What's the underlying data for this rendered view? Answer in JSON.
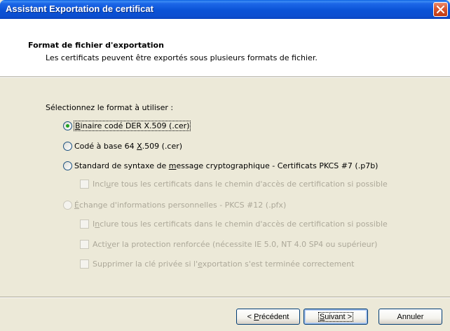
{
  "window": {
    "title": "Assistant Exportation de certificat"
  },
  "header": {
    "title": "Format de fichier d'exportation",
    "subtitle": "Les certificats peuvent être exportés sous plusieurs formats de fichier."
  },
  "prompt": "Sélectionnez le format à utiliser :",
  "options": {
    "der": {
      "mnemonic": "B",
      "rest": "inaire codé DER X.509 (.cer)",
      "selected": true
    },
    "base64": {
      "before": "Codé à base 64 ",
      "mnemonic": "X",
      "after": ".509 (.cer)",
      "selected": false
    },
    "pkcs7": {
      "before": "Standard de syntaxe de ",
      "mnemonic": "m",
      "after": "essage cryptographique - Certificats PKCS #7 (.p7b)",
      "selected": false
    },
    "pkcs7_include": {
      "before": "Incl",
      "mnemonic": "u",
      "after": "re tous les certificats dans le chemin d'accès de certification si possible",
      "checked": false,
      "enabled": false
    },
    "pfx": {
      "before": "",
      "mnemonic": "É",
      "after": "change d'informations personnelles - PKCS #12 (.pfx)",
      "selected": false,
      "enabled": false
    },
    "pfx_include": {
      "before": "I",
      "mnemonic": "n",
      "after": "clure tous les certificats dans le chemin d'accès de certification si possible",
      "checked": false,
      "enabled": false
    },
    "pfx_strong": {
      "before": "Acti",
      "mnemonic": "v",
      "after": "er la protection renforcée (nécessite IE 5.0, NT 4.0 SP4 ou supérieur)",
      "checked": false,
      "enabled": false
    },
    "pfx_delete": {
      "before": "Supprimer la clé privée si l'",
      "mnemonic": "e",
      "after": "xportation s'est terminée correctement",
      "checked": false,
      "enabled": false
    }
  },
  "buttons": {
    "back": {
      "prefix": "< ",
      "mnemonic": "P",
      "rest": "récédent"
    },
    "next": {
      "mnemonic": "S",
      "rest": "uivant >"
    },
    "cancel": {
      "label": "Annuler"
    }
  },
  "colors": {
    "titlebar": "#0a52d6",
    "dialog_bg": "#ece9d8",
    "radio_dot": "#21a121",
    "disabled_text": "#aca899",
    "close_button": "#d7552e"
  },
  "icons": {
    "close": "close-x-icon"
  }
}
